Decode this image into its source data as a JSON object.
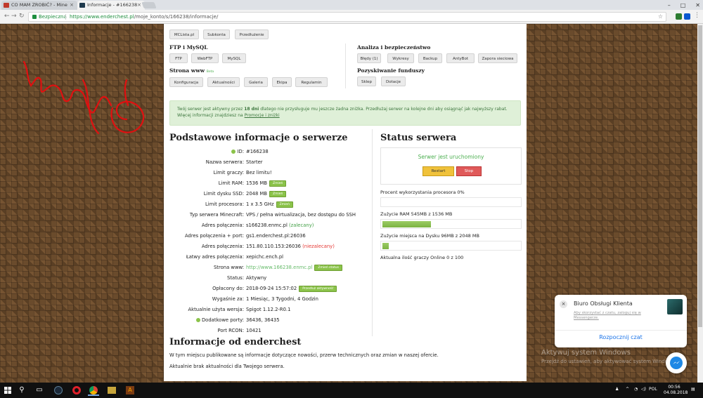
{
  "browser": {
    "tabs": [
      {
        "title": "CO MAM ZROBIĆ? - Mine",
        "active": false
      },
      {
        "title": "Informacje - #166238",
        "active": true
      }
    ],
    "secure_label": "Bezpieczna",
    "url_host": "https://www.enderchest.pl",
    "url_path": "/moje_konto/s/166238/informacje/"
  },
  "nav_groups": {
    "top_buttons": [
      "MCLista.pl",
      "Subkonta",
      "Przedłużenie"
    ],
    "ftp": {
      "title": "FTP i MySQL",
      "buttons": [
        "FTP",
        "WebFTP",
        "MySQL"
      ]
    },
    "www": {
      "title": "Strona www",
      "badge": "Beta",
      "buttons": [
        "Konfiguracja",
        "Aktualności",
        "Galeria",
        "Ekipa",
        "Regulamin"
      ]
    },
    "analysis": {
      "title": "Analiza i bezpieczeństwo",
      "buttons": [
        "Błędy (1)",
        "Wykresy",
        "Backup",
        "AntyBot",
        "Zapora sieciowa"
      ]
    },
    "funding": {
      "title": "Pozyskiwanie funduszy",
      "buttons": [
        "Sklep",
        "Dotacje"
      ]
    }
  },
  "alert": {
    "prefix": "Twój serwer jest aktywny przez ",
    "days": "18 dni",
    "suffix": " dlatego nie przysługuje mu jeszcze żadna zniżka. Przedłużaj serwer na kolejne dni aby osiągnąć jak najwyższy rabat.",
    "line2_prefix": "Więcej informacji znajdziesz na ",
    "line2_link": "Promocje i zniżki"
  },
  "basic_info": {
    "title": "Podstawowe informacje o serwerze",
    "rows": [
      {
        "label": "ID:",
        "value": "#166238"
      },
      {
        "label": "Nazwa serwera:",
        "value": "Starter"
      },
      {
        "label": "Limit graczy:",
        "value": "Bez limitu!"
      },
      {
        "label": "Limit RAM:",
        "value": "1536 MB",
        "button": "Zmień"
      },
      {
        "label": "Limit dysku SSD:",
        "value": "2048 MB",
        "button": "Zmień"
      },
      {
        "label": "Limit procesora:",
        "value": "1 x 3.5 GHz",
        "button": "Zmień"
      },
      {
        "label": "Typ serwera Minecraft:",
        "value": "VPS / pełna wirtualizacja, bez dostępu do SSH"
      },
      {
        "label": "Adres połączenia:",
        "value": "s166238.enmc.pl",
        "note": "(zalecany)"
      },
      {
        "label": "Adres połączenia + port:",
        "value": "gs1.enderchest.pl:26036"
      },
      {
        "label": "Adres połączenia:",
        "value": "151.80.110.153:26036",
        "note": "(niezalecany)"
      },
      {
        "label": "Łatwy adres połączenia:",
        "value": "xepichc.ench.pl"
      },
      {
        "label": "Strona www:",
        "value": "http://www.166238.enmc.pl",
        "button": "Zmień status"
      },
      {
        "label": "Status:",
        "value": "Aktywny"
      },
      {
        "label": "Opłacony do:",
        "value": "2018-09-24 15:57:02",
        "button": "Przedłuż aktywność"
      },
      {
        "label": "Wygaśnie za:",
        "value": "1 Miesiąc, 3 Tygodni, 4 Godzin"
      },
      {
        "label": "Aktualnie użyta wersja:",
        "value": "Spigot 1.12.2-R0.1"
      },
      {
        "label": "Dodatkowe porty:",
        "value": "36436, 36435"
      },
      {
        "label": "Port RCON:",
        "value": "10421"
      }
    ]
  },
  "server_status": {
    "title": "Status serwera",
    "running_text": "Serwer jest uruchomiony",
    "restart_label": "Restart",
    "stop_label": "Stop",
    "cpu_label": "Procent wykorzystania procesora 0%",
    "cpu_fraction": 0.0,
    "ram_label": "Zużycie RAM 545MB z 1536 MB",
    "ram_fraction": 0.355,
    "disk_label": "Zużycie miejsca na Dysku 96MB z 2048 MB",
    "disk_fraction": 0.047,
    "players_label": "Aktualna ilość graczy Online 0 z 100"
  },
  "news": {
    "title": "Informacje od enderchest",
    "line1": "W tym miejscu publikowane są informacje dotyczące nowości, przerw technicznych oraz zmian w naszej ofercie.",
    "line2": "Aktualnie brak aktualności dla Twojego serwera."
  },
  "chat_widget": {
    "title": "Biuro Obsługi Klienta",
    "subtitle": "Aby skorzystać z czatu, zaloguj się w Messengerze.",
    "start_label": "Rozpocznij czat"
  },
  "watermark": {
    "line1": "Aktywuj system Windows",
    "line2": "Przejdź do ustawień, aby aktywować system Windows."
  },
  "taskbar": {
    "lang": "POL",
    "time": "00:56",
    "date": "04.08.2018"
  },
  "colors": {
    "accent_green": "#8bc34a",
    "alert_bg": "#dff0d8",
    "restart": "#f0c23b",
    "stop": "#e05a5a"
  }
}
